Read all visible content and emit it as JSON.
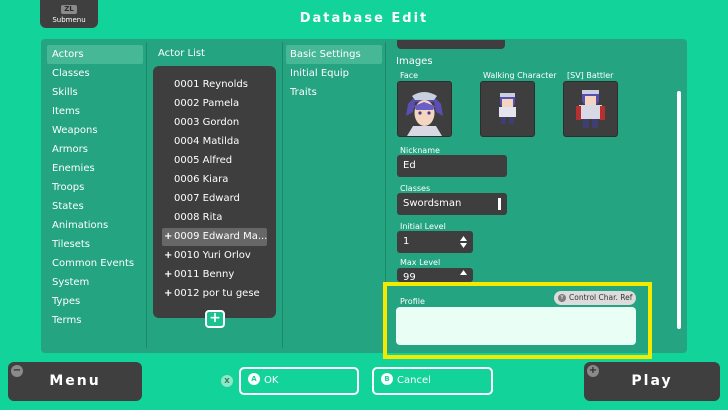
{
  "header": {
    "submenu_key": "ZL",
    "submenu_label": "Submenu",
    "title": "Database Edit"
  },
  "categories": [
    "Actors",
    "Classes",
    "Skills",
    "Items",
    "Weapons",
    "Armors",
    "Enemies",
    "Troops",
    "States",
    "Animations",
    "Tilesets",
    "Common Events",
    "System",
    "Types",
    "Terms"
  ],
  "actor_list": {
    "label": "Actor List",
    "items": [
      {
        "text": "0001 Reynolds",
        "plus": ""
      },
      {
        "text": "0002 Pamela",
        "plus": ""
      },
      {
        "text": "0003 Gordon",
        "plus": ""
      },
      {
        "text": "0004 Matilda",
        "plus": ""
      },
      {
        "text": "0005 Alfred",
        "plus": ""
      },
      {
        "text": "0006 Kiara",
        "plus": ""
      },
      {
        "text": "0007 Edward",
        "plus": ""
      },
      {
        "text": "0008 Rita",
        "plus": ""
      },
      {
        "text": "0009 Edward Ma...",
        "plus": "+"
      },
      {
        "text": "0010 Yuri Orlov",
        "plus": "+"
      },
      {
        "text": "0011 Benny",
        "plus": "+"
      },
      {
        "text": "0012 por tu gese",
        "plus": "+"
      }
    ],
    "add_label": "+"
  },
  "tabs": [
    "Basic Settings",
    "Initial Equip",
    "Traits"
  ],
  "images": {
    "label": "Images",
    "face": "Face",
    "walking": "Walking Character",
    "battler": "[SV] Battler"
  },
  "fields": {
    "nickname_label": "Nickname",
    "nickname": "Ed",
    "class_label": "Classes",
    "class": "Swordsman",
    "initial_level_label": "Initial Level",
    "initial_level": "1",
    "max_level_label": "Max Level",
    "max_level": "99",
    "profile_label": "Profile",
    "control_ref_key": "Y",
    "control_ref": "Control Char. Ref"
  },
  "footer": {
    "menu_key": "−",
    "menu": "Menu",
    "x_key": "X",
    "ok_key": "A",
    "ok": "OK",
    "cancel_key": "B",
    "cancel": "Cancel",
    "play_key": "+",
    "play": "Play"
  },
  "colors": {
    "background": "#12d39a",
    "panel": "#24a481",
    "dark": "#3e3e3e",
    "highlight": "#f3ea00"
  }
}
